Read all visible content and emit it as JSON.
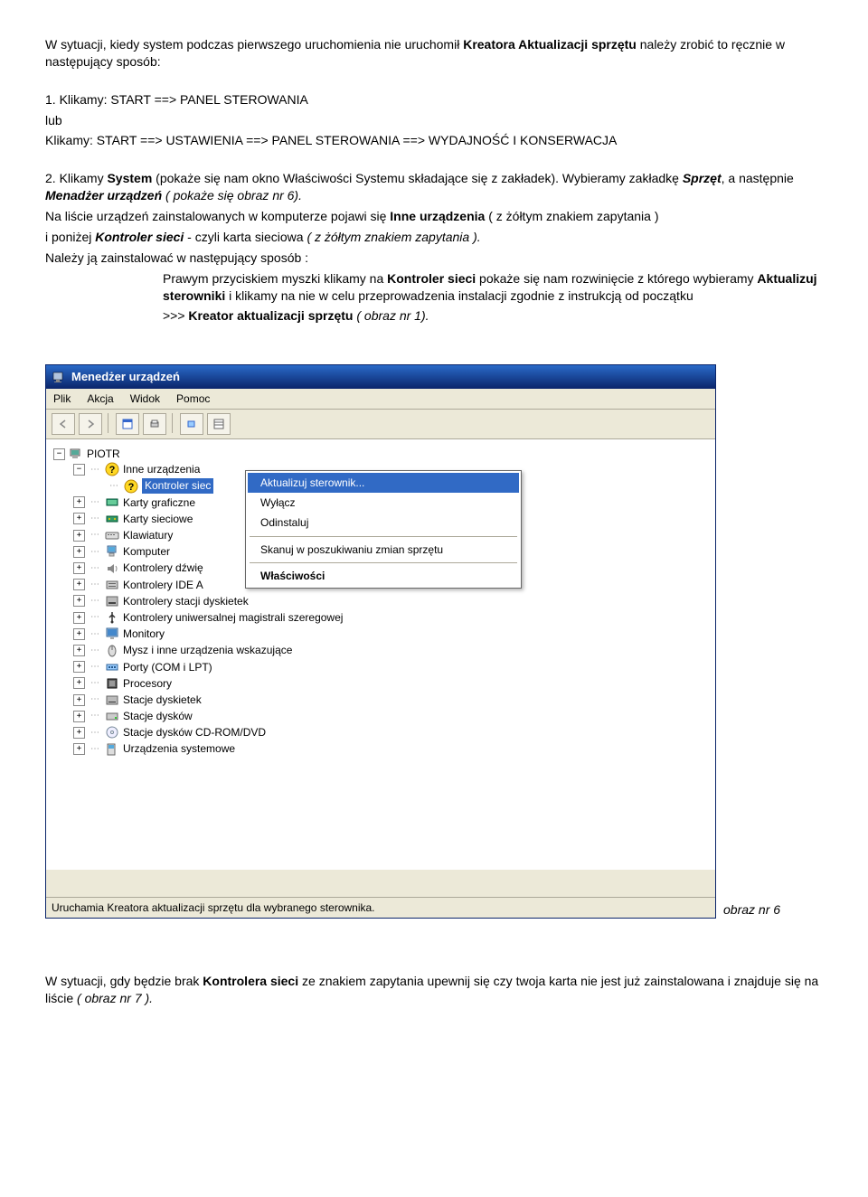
{
  "doc": {
    "p1a": "W sytuacji, kiedy system podczas pierwszego uruchomienia nie uruchomił ",
    "p1b": "Kreatora Aktualizacji sprzętu",
    "p1c": "  należy zrobić to ręcznie  w następujący sposób:",
    "p2a": "1.   Klikamy: START ==> PANEL STEROWANIA",
    "p2b": "lub",
    "p2c": "Klikamy: START ==> USTAWIENIA ==> PANEL STEROWANIA ==> WYDAJNOŚĆ I KONSERWACJA",
    "p3a": "2. Klikamy ",
    "p3b": "System",
    "p3c": "  (pokaże się nam  okno Właściwości Systemu składające się z zakładek). Wybieramy zakładkę ",
    "p3d": "Sprzęt",
    "p3e": ", a następnie ",
    "p3f": "Menadżer urządzeń",
    "p3g": " ( pokaże się obraz nr 6).",
    "p4a": "Na liście  urządzeń zainstalowanych w komputerze pojawi się  ",
    "p4b": "Inne urządzenia",
    "p4c": " ( z żółtym znakiem zapytania )",
    "p5a": "i poniżej ",
    "p5b": "Kontroler sieci",
    "p5c": "  - czyli  karta sieciowa ",
    "p5d": "( z żółtym znakiem zapytania ).",
    "p6": "Należy ją zainstalować w następujący sposób :",
    "p7a": "Prawym przyciskiem myszki klikamy na ",
    "p7b": "Kontroler sieci",
    "p7c": " pokaże się nam rozwinięcie z  którego wybieramy ",
    "p7d": "Aktualizuj sterowniki",
    "p7e": " i klikamy na nie w celu przeprowadzenia instalacji zgodnie z instrukcją od początku",
    "p8a": ">>> ",
    "p8b": "Kreator aktualizacji sprzętu",
    "p8c": "  ( obraz nr 1).",
    "caption": "obraz nr 6",
    "f1a": "W sytuacji, gdy  będzie brak ",
    "f1b": "Kontrolera sieci",
    "f1c": "  ze znakiem zapytania upewnij się czy twoja karta nie jest już zainstalowana  i znajduje się na liście ",
    "f1d": "( obraz nr  7 )."
  },
  "dm": {
    "title": "Menedżer urządzeń",
    "menu": [
      "Plik",
      "Akcja",
      "Widok",
      "Pomoc"
    ],
    "root": "PIOTR",
    "items": [
      {
        "exp": "-",
        "label": "Inne urządzenia",
        "icon": "question"
      },
      {
        "exp": "+",
        "label": "Karty graficzne",
        "icon": "display"
      },
      {
        "exp": "+",
        "label": "Karty sieciowe",
        "icon": "nic"
      },
      {
        "exp": "+",
        "label": "Klawiatury",
        "icon": "keyboard"
      },
      {
        "exp": "+",
        "label": "Komputer",
        "icon": "computer"
      },
      {
        "exp": "+",
        "label": "Kontrolery dźwię",
        "icon": "sound"
      },
      {
        "exp": "+",
        "label": "Kontrolery IDE A",
        "icon": "ide"
      },
      {
        "exp": "+",
        "label": "Kontrolery stacji dyskietek",
        "icon": "floppyctl"
      },
      {
        "exp": "+",
        "label": "Kontrolery uniwersalnej magistrali szeregowej",
        "icon": "usb"
      },
      {
        "exp": "+",
        "label": "Monitory",
        "icon": "monitor"
      },
      {
        "exp": "+",
        "label": "Mysz i inne urządzenia wskazujące",
        "icon": "mouse"
      },
      {
        "exp": "+",
        "label": "Porty (COM i LPT)",
        "icon": "ports"
      },
      {
        "exp": "+",
        "label": "Procesory",
        "icon": "cpu"
      },
      {
        "exp": "+",
        "label": "Stacje dyskietek",
        "icon": "floppy"
      },
      {
        "exp": "+",
        "label": "Stacje dysków",
        "icon": "disk"
      },
      {
        "exp": "+",
        "label": "Stacje dysków CD-ROM/DVD",
        "icon": "cd"
      },
      {
        "exp": "+",
        "label": "Urządzenia systemowe",
        "icon": "system"
      }
    ],
    "selected_sub": "Kontroler siec",
    "ctx": {
      "update": "Aktualizuj sterownik...",
      "disable": "Wyłącz",
      "uninstall": "Odinstaluj",
      "scan": "Skanuj w poszukiwaniu zmian sprzętu",
      "props": "Właściwości"
    },
    "status": "Uruchamia Kreatora aktualizacji sprzętu dla wybranego sterownika."
  }
}
